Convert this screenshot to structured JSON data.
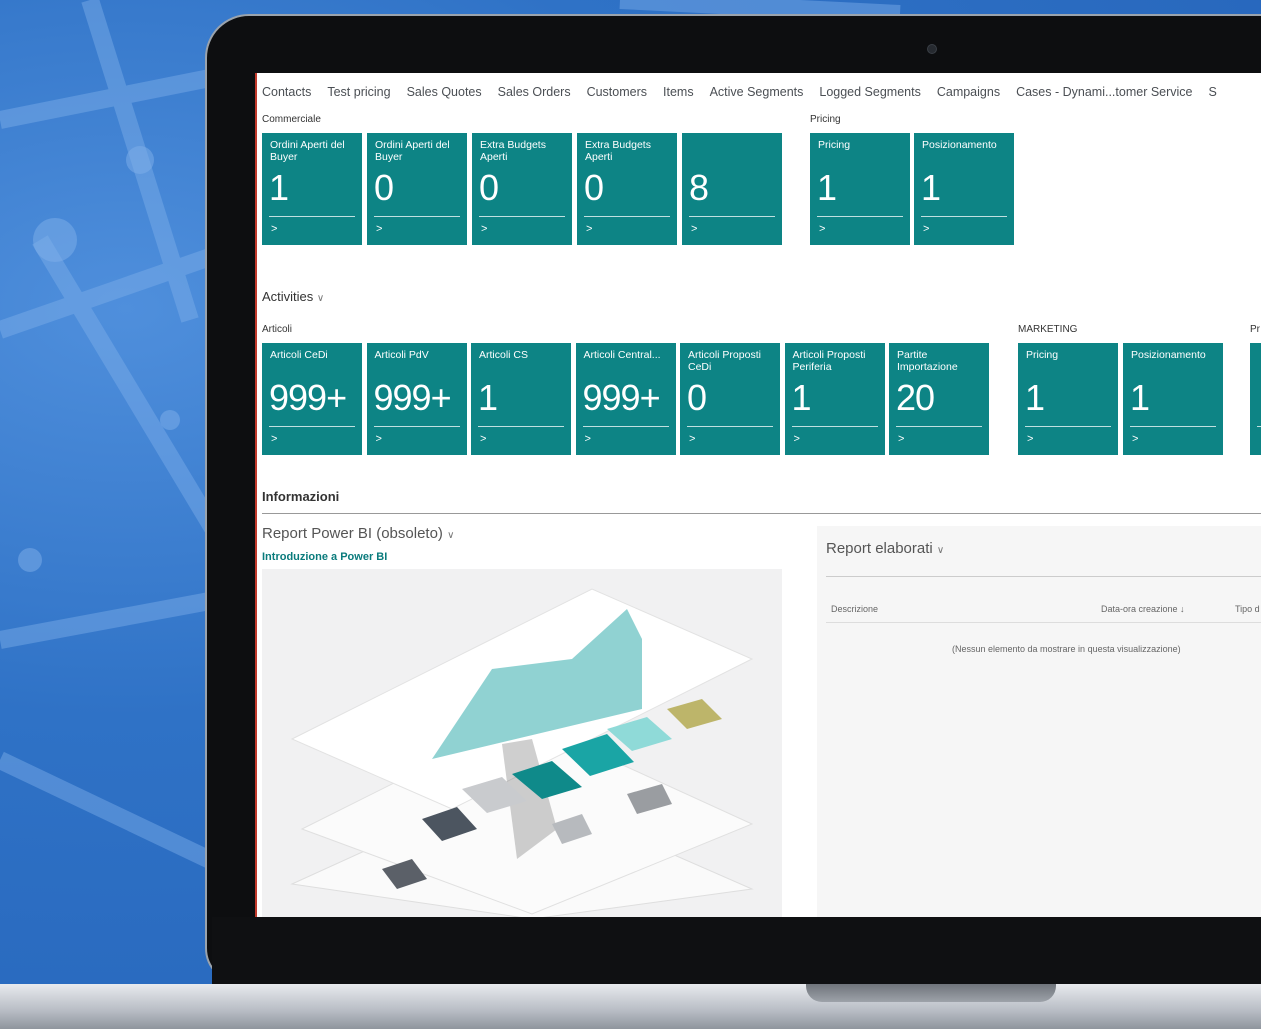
{
  "nav": [
    "Contacts",
    "Test pricing",
    "Sales Quotes",
    "Sales Orders",
    "Customers",
    "Items",
    "Active Segments",
    "Logged Segments",
    "Campaigns",
    "Cases - Dynami...tomer Service",
    "S"
  ],
  "groups": {
    "commerciale": "Commerciale",
    "pricing": "Pricing",
    "activities": "Activities",
    "articoli": "Articoli",
    "marketing": "MARKETING",
    "pr": "Pr",
    "informazioni": "Informazioni"
  },
  "tiles_top": [
    {
      "title": "Ordini Aperti del Buyer",
      "value": "1"
    },
    {
      "title": "Ordini Aperti del Buyer",
      "value": "0"
    },
    {
      "title": "Extra Budgets Aperti",
      "value": "0"
    },
    {
      "title": "Extra Budgets Aperti",
      "value": "0"
    },
    {
      "title": "",
      "value": "8"
    }
  ],
  "tiles_pricing": [
    {
      "title": "Pricing",
      "value": "1"
    },
    {
      "title": "Posizionamento",
      "value": "1"
    }
  ],
  "tiles_articoli": [
    {
      "title": "Articoli CeDi",
      "value": "999+"
    },
    {
      "title": "Articoli PdV",
      "value": "999+"
    },
    {
      "title": "Articoli CS",
      "value": "1"
    },
    {
      "title": "Articoli Central...",
      "value": "999+"
    },
    {
      "title": "Articoli Proposti CeDi",
      "value": "0"
    },
    {
      "title": "Articoli Proposti Periferia",
      "value": "1"
    },
    {
      "title": "Partite Importazione",
      "value": "20"
    }
  ],
  "tiles_marketing": [
    {
      "title": "Pricing",
      "value": "1"
    },
    {
      "title": "Posizionamento",
      "value": "1"
    }
  ],
  "tile_arrow": ">",
  "chevron": "∨",
  "powerbi": {
    "title": "Report Power BI (obsoleto)",
    "link": "Introduzione a Power BI"
  },
  "reports": {
    "title": "Report elaborati",
    "col_desc": "Descrizione",
    "col_date": "Data-ora creazione ↓",
    "col_type": "Tipo d",
    "empty": "(Nessun elemento da mostrare in questa visualizzazione)"
  },
  "colors": {
    "tile": "#0d8485",
    "accent": "#0a7b7c"
  }
}
